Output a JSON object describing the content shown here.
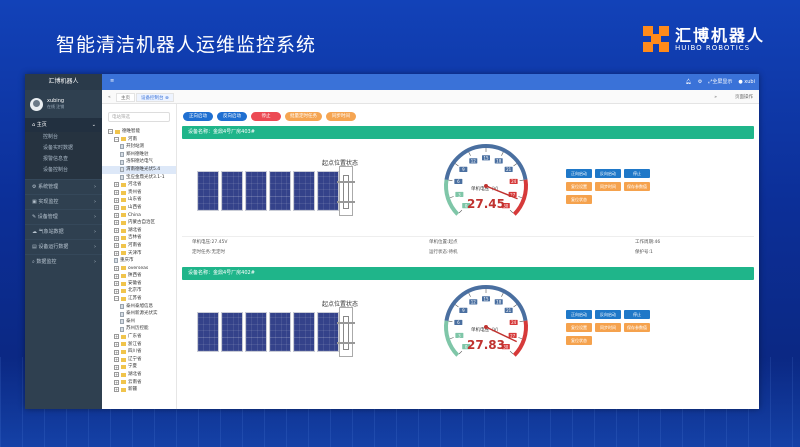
{
  "slide": {
    "title": "智能清洁机器人运维监控系统"
  },
  "logo": {
    "cn": "汇博机器人",
    "en": "HUIBO ROBOTICS",
    "color": "#ff8a1a"
  },
  "sidebar": {
    "brand": "汇博机器人",
    "user": {
      "name": "xubing",
      "status": "在线 注销"
    },
    "home": {
      "label": "主页",
      "subs": [
        "控制台",
        "设备实时数据",
        "报警信息查",
        "设备控制台"
      ]
    },
    "sections": [
      "系统管理",
      "实现监控",
      "设备管理",
      "气象站数据",
      "设备运行数据",
      "数据监控"
    ]
  },
  "topbar": {
    "menu_icon": "≡",
    "fullscreen": "全屏显示",
    "username": "xubi"
  },
  "tabs": {
    "home": "主页",
    "current": "设备控制台",
    "close_action": "页面操作"
  },
  "tree": {
    "search_placeholder": "电站筛选",
    "nodes": [
      {
        "label": "德唯智能",
        "level": 0,
        "type": "folder",
        "toggle": "−"
      },
      {
        "label": "河南",
        "level": 1,
        "type": "folder",
        "toggle": "−"
      },
      {
        "label": "开封站测",
        "level": 2,
        "type": "file"
      },
      {
        "label": "郑州德唯驻",
        "level": 2,
        "type": "file"
      },
      {
        "label": "洛阳德达电气",
        "level": 2,
        "type": "file"
      },
      {
        "label": "渭南德唯光伏5.4",
        "level": 2,
        "type": "file",
        "selected": true
      },
      {
        "label": "宝应金鼎光伏3.1-1",
        "level": 2,
        "type": "file"
      },
      {
        "label": "河北省",
        "level": 1,
        "type": "folder",
        "toggle": "+"
      },
      {
        "label": "贵州省",
        "level": 1,
        "type": "folder",
        "toggle": "+"
      },
      {
        "label": "山东省",
        "level": 1,
        "type": "folder",
        "toggle": "+"
      },
      {
        "label": "山西省",
        "level": 1,
        "type": "folder",
        "toggle": "+"
      },
      {
        "label": "China",
        "level": 1,
        "type": "folder",
        "toggle": "+"
      },
      {
        "label": "内蒙古自治区",
        "level": 1,
        "type": "folder",
        "toggle": "+"
      },
      {
        "label": "湖北省",
        "level": 1,
        "type": "folder",
        "toggle": "+"
      },
      {
        "label": "吉林省",
        "level": 1,
        "type": "folder",
        "toggle": "+"
      },
      {
        "label": "河南省",
        "level": 1,
        "type": "folder",
        "toggle": "+"
      },
      {
        "label": "天津市",
        "level": 1,
        "type": "folder",
        "toggle": "+"
      },
      {
        "label": "重庆市",
        "level": 1,
        "type": "file"
      },
      {
        "label": "overseas",
        "level": 1,
        "type": "folder",
        "toggle": "+"
      },
      {
        "label": "陕西省",
        "level": 1,
        "type": "folder",
        "toggle": "+"
      },
      {
        "label": "安徽省",
        "level": 1,
        "type": "folder",
        "toggle": "+"
      },
      {
        "label": "北京市",
        "level": 1,
        "type": "folder",
        "toggle": "+"
      },
      {
        "label": "江苏省",
        "level": 1,
        "type": "folder",
        "toggle": "−"
      },
      {
        "label": "泰州泰旭信息",
        "level": 2,
        "type": "file"
      },
      {
        "label": "泰州新源光伏实",
        "level": 2,
        "type": "file"
      },
      {
        "label": "泰州",
        "level": 2,
        "type": "file"
      },
      {
        "label": "苏州历控能",
        "level": 2,
        "type": "file"
      },
      {
        "label": "广东省",
        "level": 1,
        "type": "folder",
        "toggle": "+"
      },
      {
        "label": "浙江省",
        "level": 1,
        "type": "folder",
        "toggle": "+"
      },
      {
        "label": "四川省",
        "level": 1,
        "type": "folder",
        "toggle": "+"
      },
      {
        "label": "辽宁省",
        "level": 1,
        "type": "folder",
        "toggle": "+"
      },
      {
        "label": "宁夏",
        "level": 1,
        "type": "folder",
        "toggle": "+"
      },
      {
        "label": "湖北省",
        "level": 1,
        "type": "folder",
        "toggle": "+"
      },
      {
        "label": "云南省",
        "level": 1,
        "type": "folder",
        "toggle": "+"
      },
      {
        "label": "新疆",
        "level": 1,
        "type": "folder",
        "toggle": "+"
      }
    ]
  },
  "actions": [
    {
      "label": "正向启动",
      "color": "#1f6fd1"
    },
    {
      "label": "反向启动",
      "color": "#1f6fd1"
    },
    {
      "label": "停止",
      "color": "#ec4a54"
    },
    {
      "label": "批量定时任务",
      "color": "#f5a552"
    },
    {
      "label": "同步时间",
      "color": "#f5a552"
    }
  ],
  "devices": [
    {
      "header": "设备名称：金鼎4号厂房403#",
      "status_title": "起点位置状态",
      "gauge": {
        "label": "单机电压（V）",
        "value": "27.45",
        "value_num": 27.45,
        "min": 0,
        "max": 30,
        "ticks": [
          "0",
          "3",
          "6",
          "9",
          "12",
          "15",
          "18",
          "21",
          "24",
          "27",
          "30"
        ]
      },
      "controls": [
        "正向启动",
        "反向启动",
        "停止",
        "复位设置",
        "同步时间",
        "保存参数值",
        "复位状态"
      ],
      "info": [
        [
          "单机电压:27.45V",
          "单机位置:起点",
          "工作周期:46"
        ],
        [
          "定时任务:无定时",
          "运行状态:待机",
          "保护号:1"
        ]
      ]
    },
    {
      "header": "设备名称：金鼎4号厂房402#",
      "status_title": "起点位置状态",
      "gauge": {
        "label": "单机电压（V）",
        "value": "27.83",
        "value_num": 27.83,
        "min": 0,
        "max": 30,
        "ticks": [
          "0",
          "3",
          "6",
          "9",
          "12",
          "15",
          "18",
          "21",
          "24",
          "27",
          "30"
        ]
      },
      "controls": [
        "正向启动",
        "反向启动",
        "停止",
        "复位设置",
        "同步时间",
        "保存参数值",
        "复位状态"
      ],
      "info": []
    }
  ],
  "colors": {
    "header_green": "#1fb58a",
    "topbar": "#3a72d8",
    "sidebar": "#2f4050",
    "gauge_red": "#d63a3a",
    "gauge_blue": "#4a6fa0",
    "gauge_green": "#7fc6a8"
  }
}
